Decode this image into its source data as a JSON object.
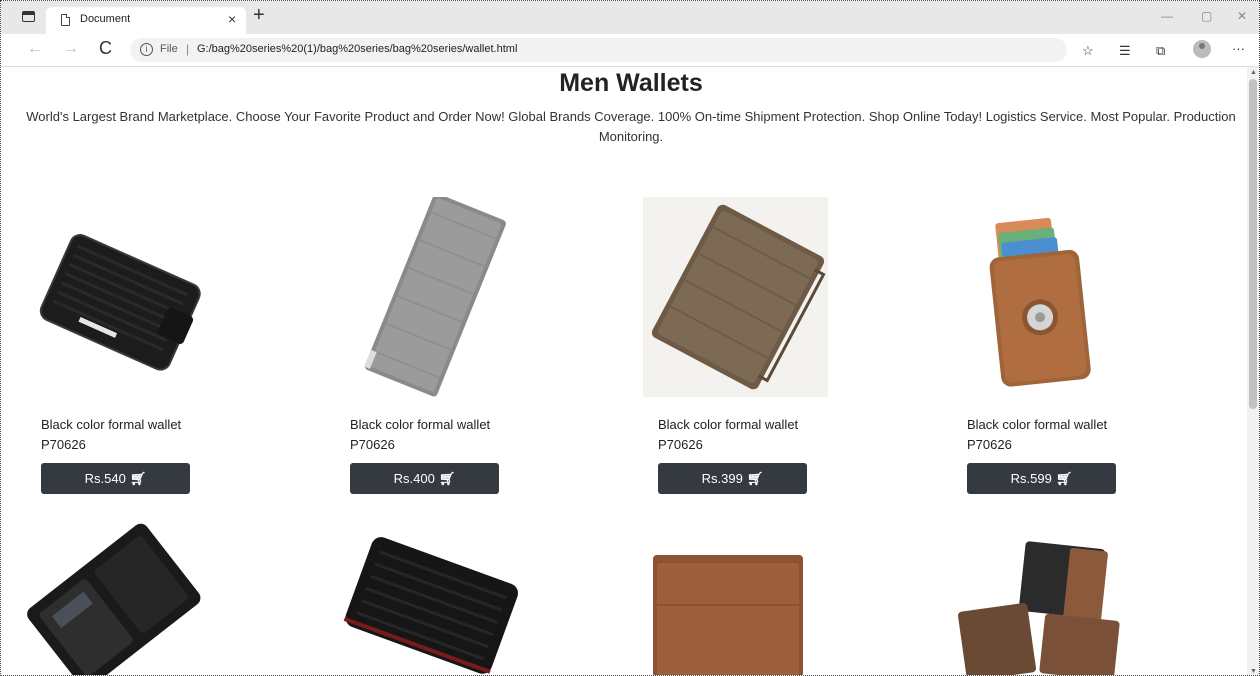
{
  "browser": {
    "tab_title": "Document",
    "tab_close": "×",
    "new_tab": "+",
    "win_minimize": "—",
    "win_restore": "▢",
    "win_close": "✕",
    "back": "←",
    "forward": "→",
    "reload": "C",
    "address_label": "File",
    "address_separator": "|",
    "url": "G:/bag%20series%20(1)/bag%20series/bag%20series/wallet.html",
    "more": "···"
  },
  "page": {
    "title": "Men Wallets",
    "description": "World's Largest Brand Marketplace. Choose Your Favorite Product and Order Now! Global Brands Coverage. 100% On-time Shipment Protection. Shop Online Today! Logistics Service. Most Popular. Production Monitoring.",
    "products": [
      {
        "name": "Black color formal wallet",
        "code": "P70626",
        "price": "Rs.540",
        "cart_icon": "cart-icon"
      },
      {
        "name": "Black color formal wallet",
        "code": "P70626",
        "price": "Rs.400",
        "cart_icon": "cart-icon"
      },
      {
        "name": "Black color formal wallet",
        "code": "P70626",
        "price": "Rs.399",
        "cart_icon": "cart-icon"
      },
      {
        "name": "Black color formal wallet",
        "code": "P70626",
        "price": "Rs.599",
        "cart_icon": "cart-icon"
      }
    ]
  },
  "colors": {
    "button_bg": "#343a40",
    "button_text": "#ffffff"
  }
}
